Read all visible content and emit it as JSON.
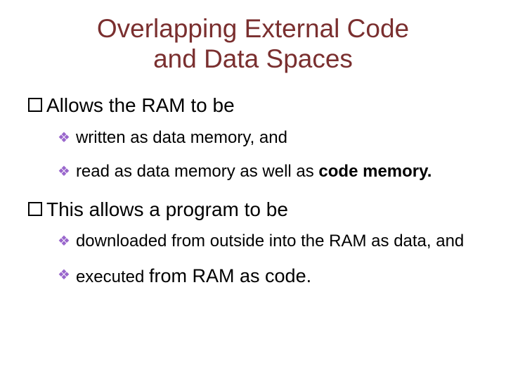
{
  "title_line1": "Overlapping External Code",
  "title_line2": "and Data Spaces",
  "item1": "Allows the RAM to be",
  "item1_sub1": " written as data memory, and",
  "item1_sub2_prefix": "read as data memory as well as ",
  "item1_sub2_bold": "code memory.",
  "item2": "This allows a program to be",
  "item2_sub1": "downloaded from outside into the RAM as data, and",
  "item2_sub2_prefix": "executed ",
  "item2_sub2_rest": "from RAM as code."
}
